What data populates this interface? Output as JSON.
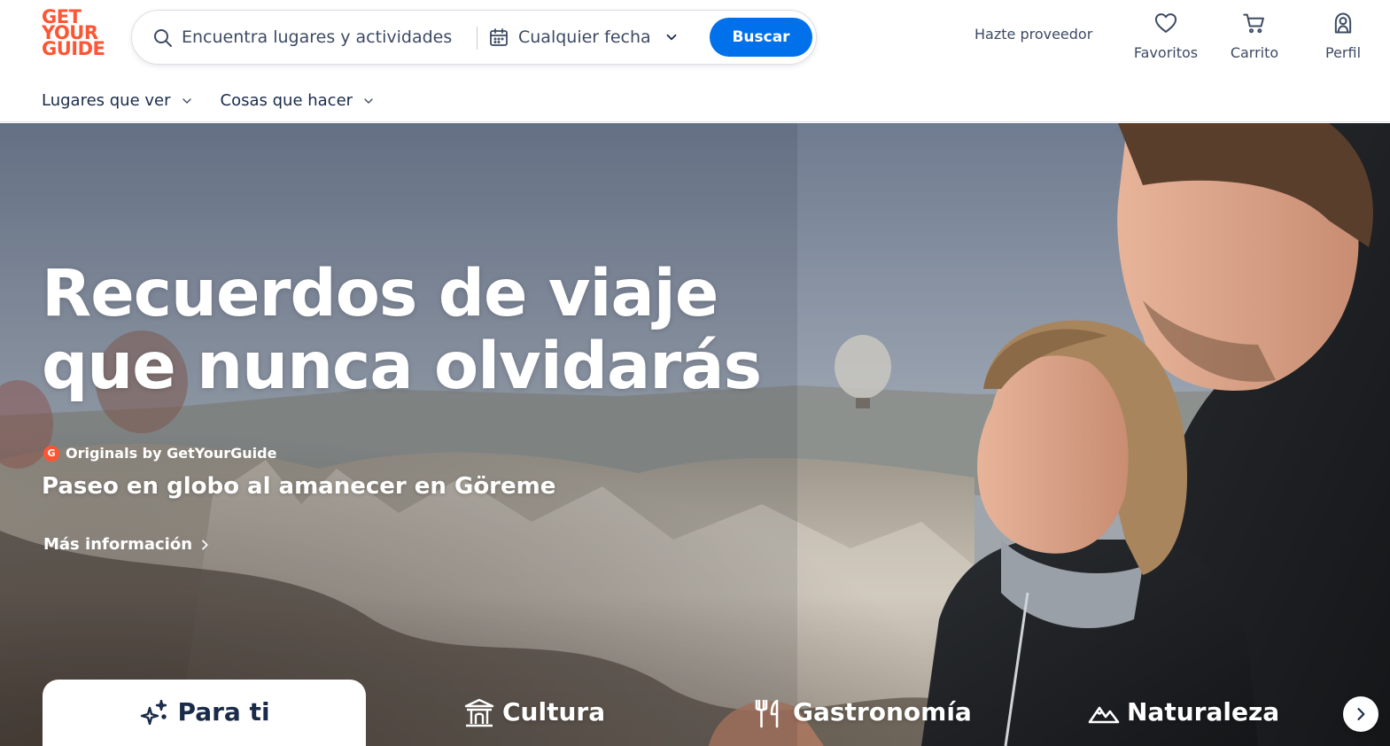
{
  "brand": {
    "logo_lines": [
      "GET",
      "YOUR",
      "GUIDE"
    ],
    "accent_color": "#ff5533",
    "primary_button_color": "#0071eb"
  },
  "search": {
    "placeholder": "Encuentra lugares y actividades",
    "date_label": "Cualquier fecha",
    "button_label": "Buscar"
  },
  "header": {
    "supplier_link": "Hazte proveedor",
    "actions": [
      {
        "label": "Favoritos",
        "icon": "heart-icon"
      },
      {
        "label": "Carrito",
        "icon": "cart-icon"
      },
      {
        "label": "Perfil",
        "icon": "profile-icon"
      }
    ]
  },
  "subnav": {
    "items": [
      {
        "label": "Lugares que ver"
      },
      {
        "label": "Cosas que hacer"
      }
    ]
  },
  "hero": {
    "title": "Recuerdos de viaje que nunca olvidarás",
    "badge_letter": "G",
    "originals": "Originals by GetYourGuide",
    "subtitle": "Paseo en globo al amanecer en Göreme",
    "more_info": "Más información"
  },
  "categories": {
    "tabs": [
      {
        "label": "Para ti",
        "icon": "sparkle-icon",
        "active": true
      },
      {
        "label": "Cultura",
        "icon": "museum-icon",
        "active": false
      },
      {
        "label": "Gastronomía",
        "icon": "fork-knife-icon",
        "active": false
      },
      {
        "label": "Naturaleza",
        "icon": "mountain-icon",
        "active": false
      }
    ],
    "next_icon": "chevron-right-icon"
  }
}
